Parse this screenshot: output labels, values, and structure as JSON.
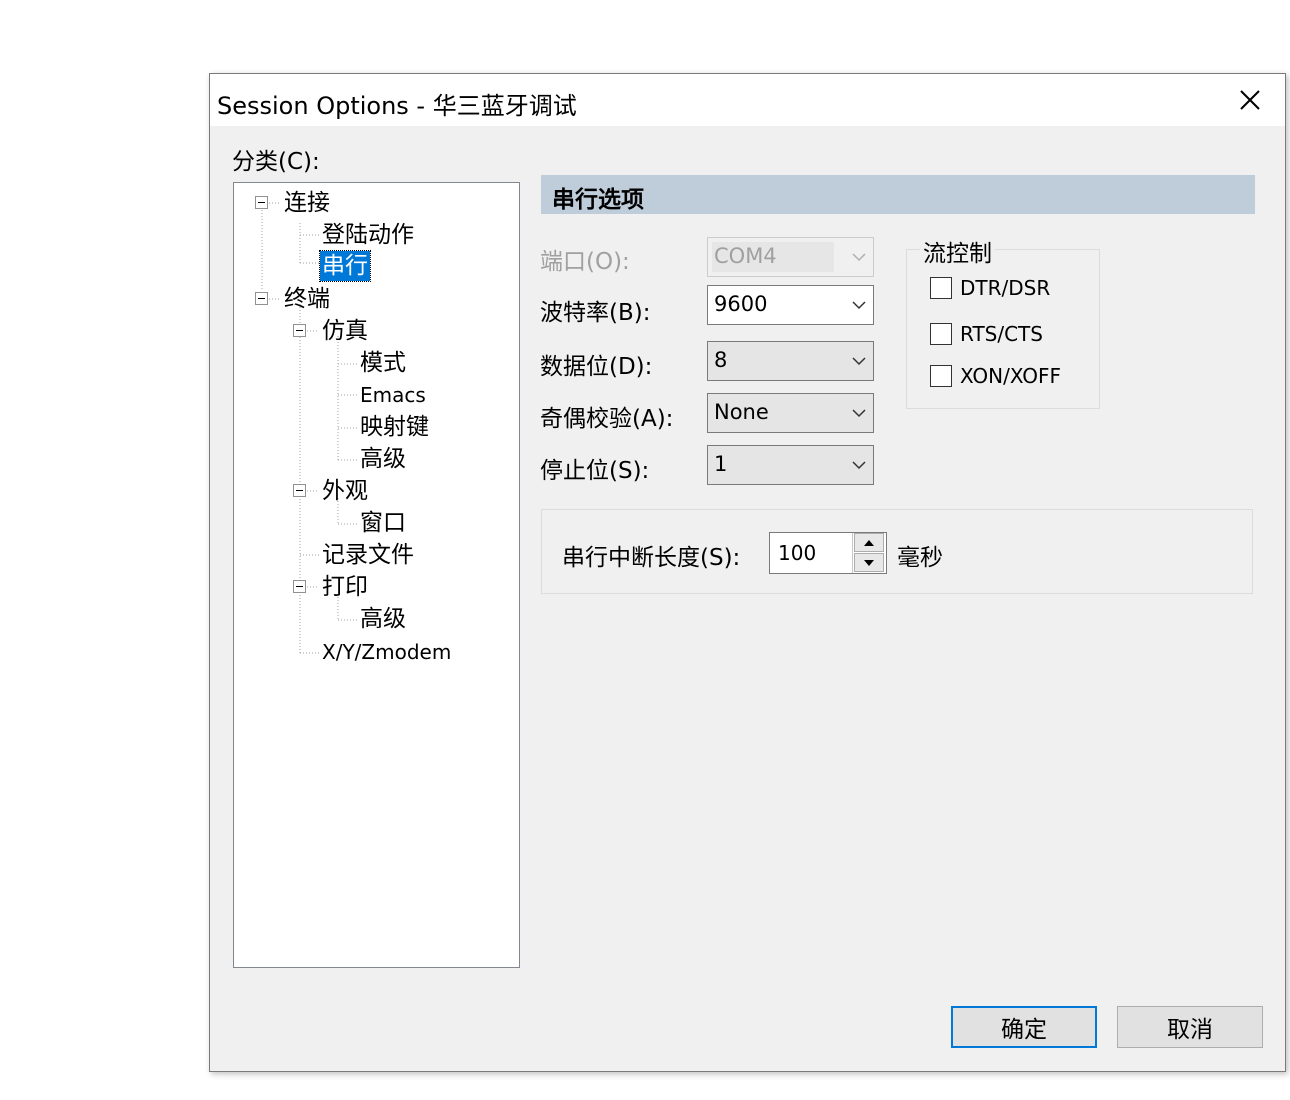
{
  "window": {
    "title": "Session Options - 华三蓝牙调试"
  },
  "category_label": "分类(C):",
  "tree": {
    "items": [
      {
        "label": "连接"
      },
      {
        "label": "登陆动作"
      },
      {
        "label": "串行",
        "selected": true
      },
      {
        "label": "终端"
      },
      {
        "label": "仿真"
      },
      {
        "label": "模式"
      },
      {
        "label": "Emacs"
      },
      {
        "label": "映射键"
      },
      {
        "label": "高级"
      },
      {
        "label": "外观"
      },
      {
        "label": "窗口"
      },
      {
        "label": "记录文件"
      },
      {
        "label": "打印"
      },
      {
        "label": "高级"
      },
      {
        "label": "X/Y/Zmodem"
      }
    ]
  },
  "panel": {
    "title": "串行选项",
    "fields": {
      "port": {
        "label": "端口(O):",
        "value": "COM4",
        "disabled": true
      },
      "baud": {
        "label": "波特率(B):",
        "value": "9600"
      },
      "data_bits": {
        "label": "数据位(D):",
        "value": "8"
      },
      "parity": {
        "label": "奇偶校验(A):",
        "value": "None"
      },
      "stop_bits": {
        "label": "停止位(S):",
        "value": "1"
      }
    },
    "flow_control": {
      "title": "流控制",
      "options": [
        {
          "label": "DTR/DSR",
          "checked": false
        },
        {
          "label": "RTS/CTS",
          "checked": false
        },
        {
          "label": "XON/XOFF",
          "checked": false
        }
      ]
    },
    "break_length": {
      "label": "串行中断长度(S):",
      "value": "100",
      "unit": "毫秒"
    }
  },
  "buttons": {
    "ok": "确定",
    "cancel": "取消"
  }
}
